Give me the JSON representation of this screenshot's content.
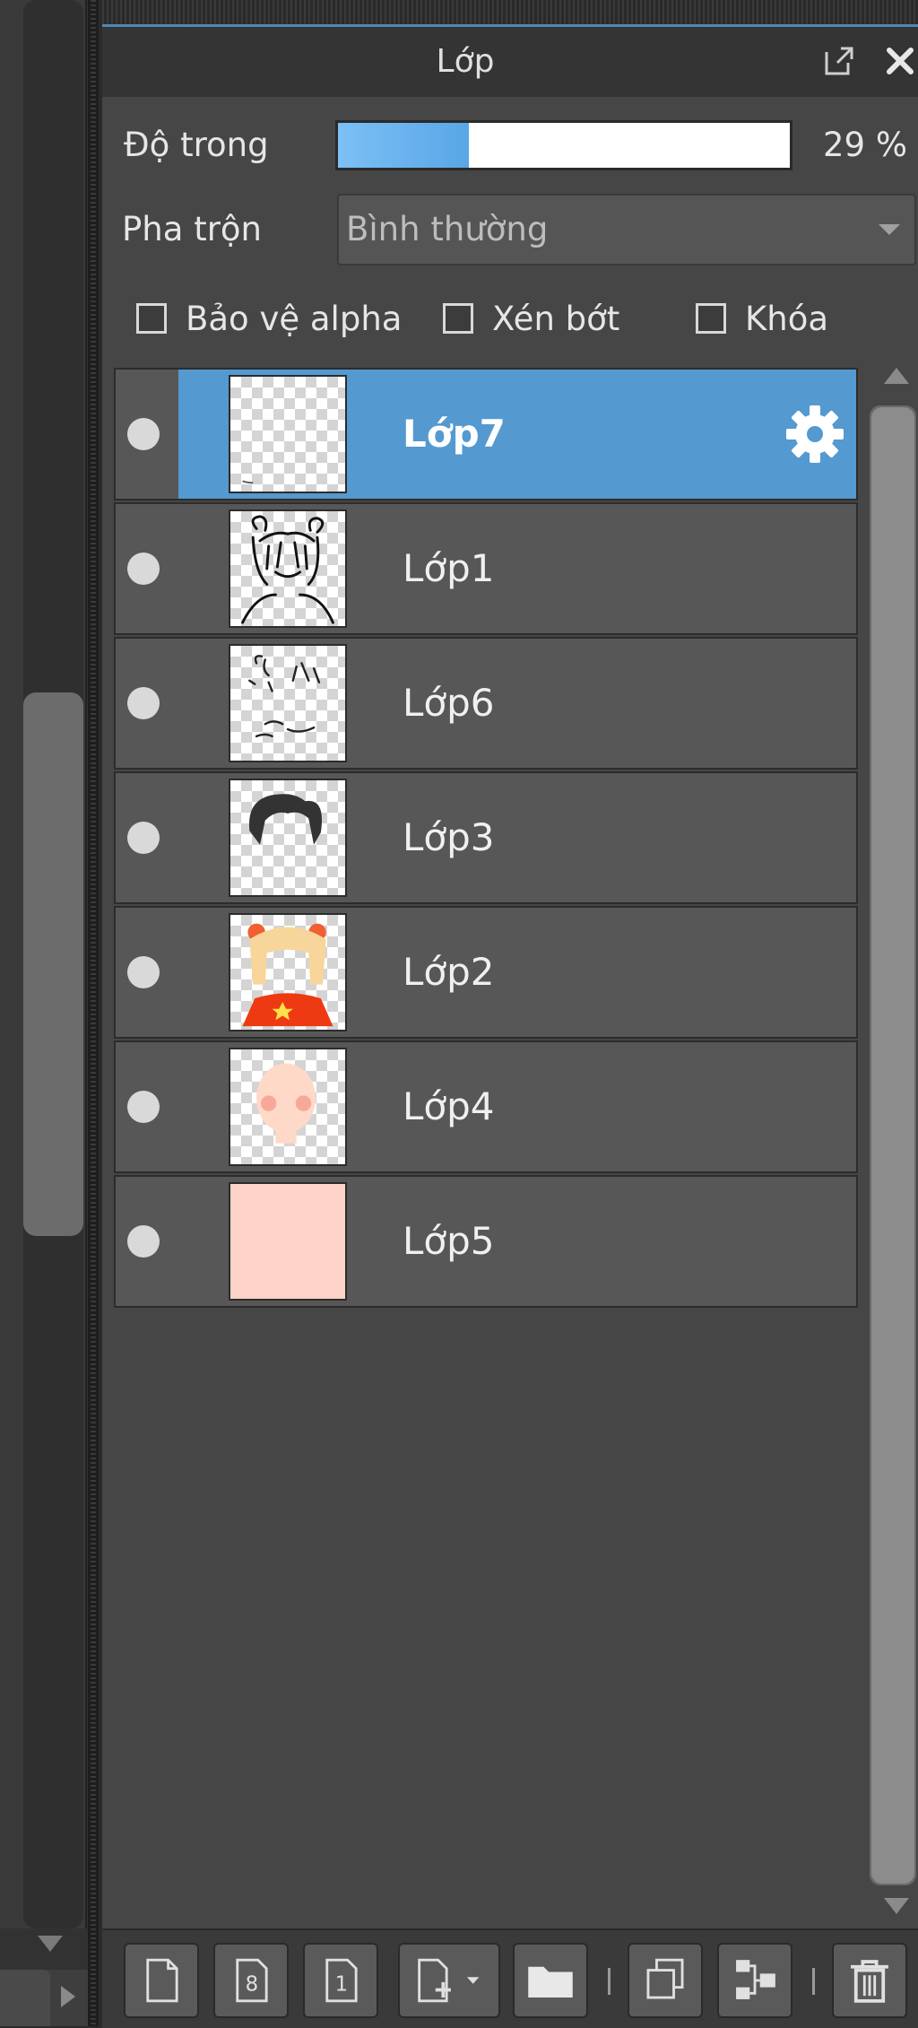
{
  "panel": {
    "title": "Lớp",
    "opacity_label": "Độ trong",
    "opacity_value": "29 %",
    "opacity_fraction": 0.29,
    "blend_label": "Pha trộn",
    "blend_value": "Bình thường",
    "checkboxes": [
      {
        "label": "Bảo vệ alpha",
        "checked": false
      },
      {
        "label": "Xén bớt",
        "checked": false
      },
      {
        "label": "Khóa",
        "checked": false
      }
    ]
  },
  "layers": [
    {
      "name": "Lớp7",
      "selected": true,
      "icon": "blank-thumbnail"
    },
    {
      "name": "Lớp1",
      "selected": false,
      "icon": "line-art-thumbnail"
    },
    {
      "name": "Lớp6",
      "selected": false,
      "icon": "sketch-thumbnail"
    },
    {
      "name": "Lớp3",
      "selected": false,
      "icon": "hair-thumbnail"
    },
    {
      "name": "Lớp2",
      "selected": false,
      "icon": "color-thumbnail"
    },
    {
      "name": "Lớp4",
      "selected": false,
      "icon": "skin-thumbnail"
    },
    {
      "name": "Lớp5",
      "selected": false,
      "icon": "background-thumbnail"
    }
  ],
  "colors": {
    "selected_row": "#5499d0",
    "opacity_fill": "#59a6e6",
    "background_layer": "#ffd4c8"
  },
  "toolbar_icons": [
    "new-layer-icon",
    "new-8bit-layer-icon",
    "new-1bit-layer-icon",
    "add-layer-menu-icon",
    "new-folder-icon",
    "duplicate-layer-icon",
    "merge-layer-icon",
    "delete-layer-icon"
  ]
}
